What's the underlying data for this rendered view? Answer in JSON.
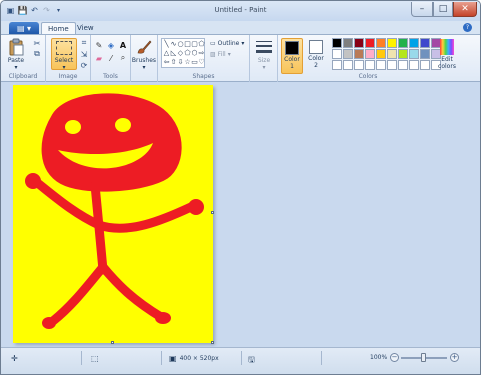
{
  "window": {
    "title": "Untitled - Paint",
    "controls": {
      "minimize": "–",
      "maximize": "□",
      "close": "✕"
    }
  },
  "tabs": [
    {
      "label": "Home",
      "active": true
    },
    {
      "label": "View",
      "active": false
    }
  ],
  "ribbon": {
    "clipboard": {
      "paste_label": "Paste",
      "group_label": "Clipboard"
    },
    "image": {
      "select_label": "Select",
      "group_label": "Image"
    },
    "tools": {
      "group_label": "Tools"
    },
    "brushes": {
      "label": "Brushes"
    },
    "shapes": {
      "outline_label": "Outline",
      "fill_label": "Fill",
      "group_label": "Shapes"
    },
    "size": {
      "label": "Size"
    },
    "colors": {
      "color1_label": "Color\n1",
      "color2_label": "Color\n2",
      "edit_label": "Edit\ncolors",
      "group_label": "Colors",
      "color1_value": "#000000",
      "color2_value": "#ffffff",
      "palette": [
        "#000000",
        "#7f7f7f",
        "#880015",
        "#ed1c24",
        "#ff7f27",
        "#fff200",
        "#22b14c",
        "#00a2e8",
        "#3f48cc",
        "#a349a4",
        "#ffffff",
        "#c3c3c3",
        "#b97a57",
        "#ffaec9",
        "#ffc90e",
        "#efe4b0",
        "#b5e61d",
        "#99d9ea",
        "#7092be",
        "#c8bfe7",
        "#ffffff",
        "#ffffff",
        "#ffffff",
        "#ffffff",
        "#ffffff",
        "#ffffff",
        "#ffffff",
        "#ffffff",
        "#ffffff",
        "#ffffff"
      ]
    }
  },
  "canvas": {
    "background_color": "#ffff00",
    "drawing_color": "#ed1c24"
  },
  "status": {
    "image_size": "400 × 520px",
    "zoom": "100%"
  }
}
